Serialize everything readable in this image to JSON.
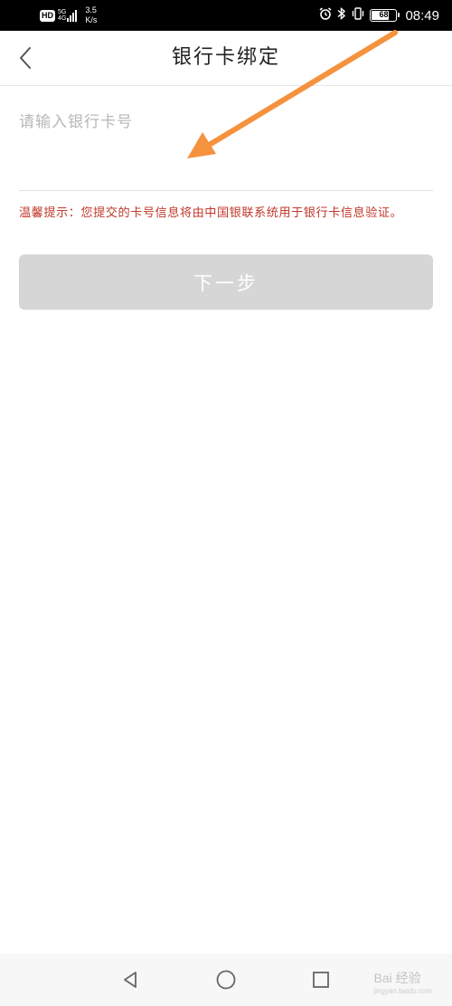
{
  "status_bar": {
    "hd": "HD",
    "network_type": "5G",
    "network_sub": "4G",
    "speed_value": "3.5",
    "speed_unit": "K/s",
    "battery": "68",
    "time": "08:49",
    "icons": [
      "alarm-icon",
      "bluetooth-icon",
      "vibrate-icon",
      "battery-icon"
    ]
  },
  "header": {
    "title": "银行卡绑定",
    "back_icon": "chevron-left-icon"
  },
  "form": {
    "card_number_placeholder": "请输入银行卡号",
    "card_number_value": "",
    "tip": "温馨提示：您提交的卡号信息将由中国银联系统用于银行卡信息验证。",
    "next_label": "下一步"
  },
  "nav_bar": {
    "icons": [
      "back-triangle-icon",
      "home-circle-icon",
      "recents-square-icon"
    ]
  },
  "watermark": {
    "text": "Bai 经验",
    "sub": "jingyan.baidu.com"
  },
  "colors": {
    "tip_text": "#c0392b",
    "button_disabled": "#d6d6d6",
    "annotation_arrow": "#f5923e"
  }
}
